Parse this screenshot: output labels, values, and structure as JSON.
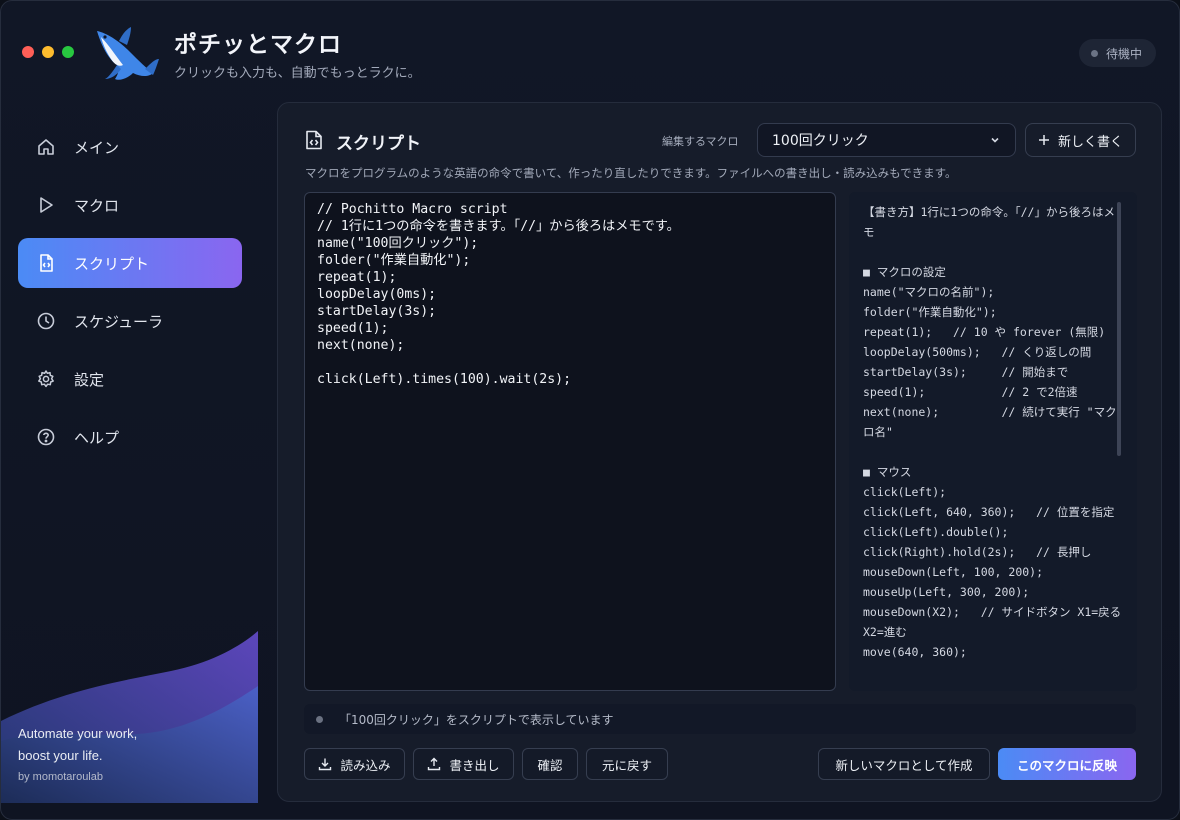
{
  "app": {
    "title": "ポチッとマクロ",
    "subtitle": "クリックも入力も、自動でもっとラクに。",
    "status": "待機中"
  },
  "sidebar": {
    "items": [
      {
        "label": "メイン",
        "icon": "home-icon"
      },
      {
        "label": "マクロ",
        "icon": "play-icon"
      },
      {
        "label": "スクリプト",
        "icon": "script-icon",
        "active": true
      },
      {
        "label": "スケジューラ",
        "icon": "clock-icon"
      },
      {
        "label": "設定",
        "icon": "gear-icon"
      },
      {
        "label": "ヘルプ",
        "icon": "help-icon"
      }
    ],
    "tagline_1": "Automate your work,",
    "tagline_2": "boost your life.",
    "byline": "by momotaroulab"
  },
  "script": {
    "title": "スクリプト",
    "editing_label": "編集するマクロ",
    "selected_macro": "100回クリック",
    "new_button": "新しく書く",
    "description": "マクロをプログラムのような英語の命令で書いて、作ったり直したりできます。ファイルへの書き出し・読み込みもできます。",
    "code": [
      "// Pochitto Macro script",
      "// 1行に1つの命令を書きます。「//」から後ろはメモです。",
      "name(\"100回クリック\");",
      "folder(\"作業自動化\");",
      "repeat(1);",
      "loopDelay(0ms);",
      "startDelay(3s);",
      "speed(1);",
      "next(none);",
      "",
      "click(Left).times(100).wait(2s);"
    ],
    "reference": [
      "【書き方】1行に1つの命令。「//」から後ろはメモ",
      "",
      "■ マクロの設定",
      "name(\"マクロの名前\");",
      "folder(\"作業自動化\");",
      "repeat(1);   // 10 や forever (無限)",
      "loopDelay(500ms);   // くり返しの間",
      "startDelay(3s);     // 開始まで",
      "speed(1);           // 2 で2倍速",
      "next(none);         // 続けて実行 \"マクロ名\"",
      "",
      "■ マウス",
      "click(Left);",
      "click(Left, 640, 360);   // 位置を指定",
      "click(Left).double();",
      "click(Right).hold(2s);   // 長押し",
      "mouseDown(Left, 100, 200);",
      "mouseUp(Left, 300, 200);",
      "mouseDown(X2);   // サイドボタン X1=戻る X2=進む",
      "move(640, 360);"
    ],
    "status_message": "「100回クリック」をスクリプトで表示しています",
    "buttons": {
      "import": "読み込み",
      "export": "書き出し",
      "check": "確認",
      "revert": "元に戻す",
      "create_new": "新しいマクロとして作成",
      "apply": "このマクロに反映"
    }
  }
}
